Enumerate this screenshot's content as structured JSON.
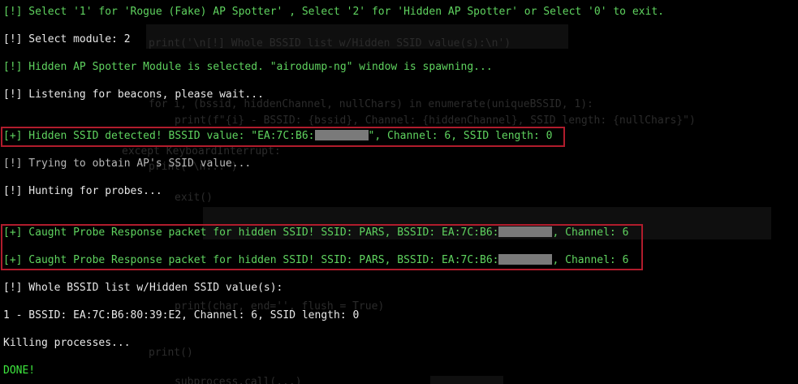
{
  "lines": {
    "select_prompt": "[!] Select '1' for 'Rogue (Fake) AP Spotter' , Select '2' for 'Hidden AP Spotter' or Select '0' to exit.",
    "select_module": "[!] Select module: 2",
    "module_selected": "[!] Hidden AP Spotter Module is selected. \"airodump-ng\" window is spawning...",
    "listening": "[!] Listening for beacons, please wait...",
    "hidden_detected_pre": "[+] Hidden SSID detected! BSSID value: \"EA:7C:B6:",
    "hidden_detected_post": "\", Channel: 6, SSID length: 0",
    "trying": "[!] Trying to obtain AP's SSID value...",
    "hunting": "[!] Hunting for probes...",
    "probe_pre": "[+] Caught Probe Response packet for hidden SSID! SSID: PARS, BSSID: EA:7C:B6:",
    "probe_post": ", Channel: 6",
    "whole_list": "[!] Whole BSSID list w/Hidden SSID value(s):",
    "list_entry": "1 - BSSID: EA:7C:B6:80:39:E2, Channel: 6, SSID length: 0",
    "killing": "Killing processes...",
    "done": "DONE!"
  },
  "background_code": {
    "l1": "print('\\n[!] Whole BSSID list w/Hidden SSID value(s):\\n')",
    "l2": "for i, (bssid, hiddenChannel, nullChars) in enumerate(uniqueBSSID, 1):",
    "l3": "print(f\"{i} - BSSID: {bssid}, Channel: {hiddenChannel}, SSID length: {nullChars}\")",
    "l4": "except KeyboardInterrupt:",
    "l5": "print('\\n...')",
    "l6": "exit()",
    "l7": "print(char, end='', flush = True)",
    "l8": "print()",
    "l9": "subprocess.call(...)"
  },
  "colors": {
    "background": "#000000",
    "green_text": "#5fd35f",
    "white_text": "#e8e8e8",
    "highlight_box": "#b01c2c",
    "redaction": "#7a7a7a"
  }
}
